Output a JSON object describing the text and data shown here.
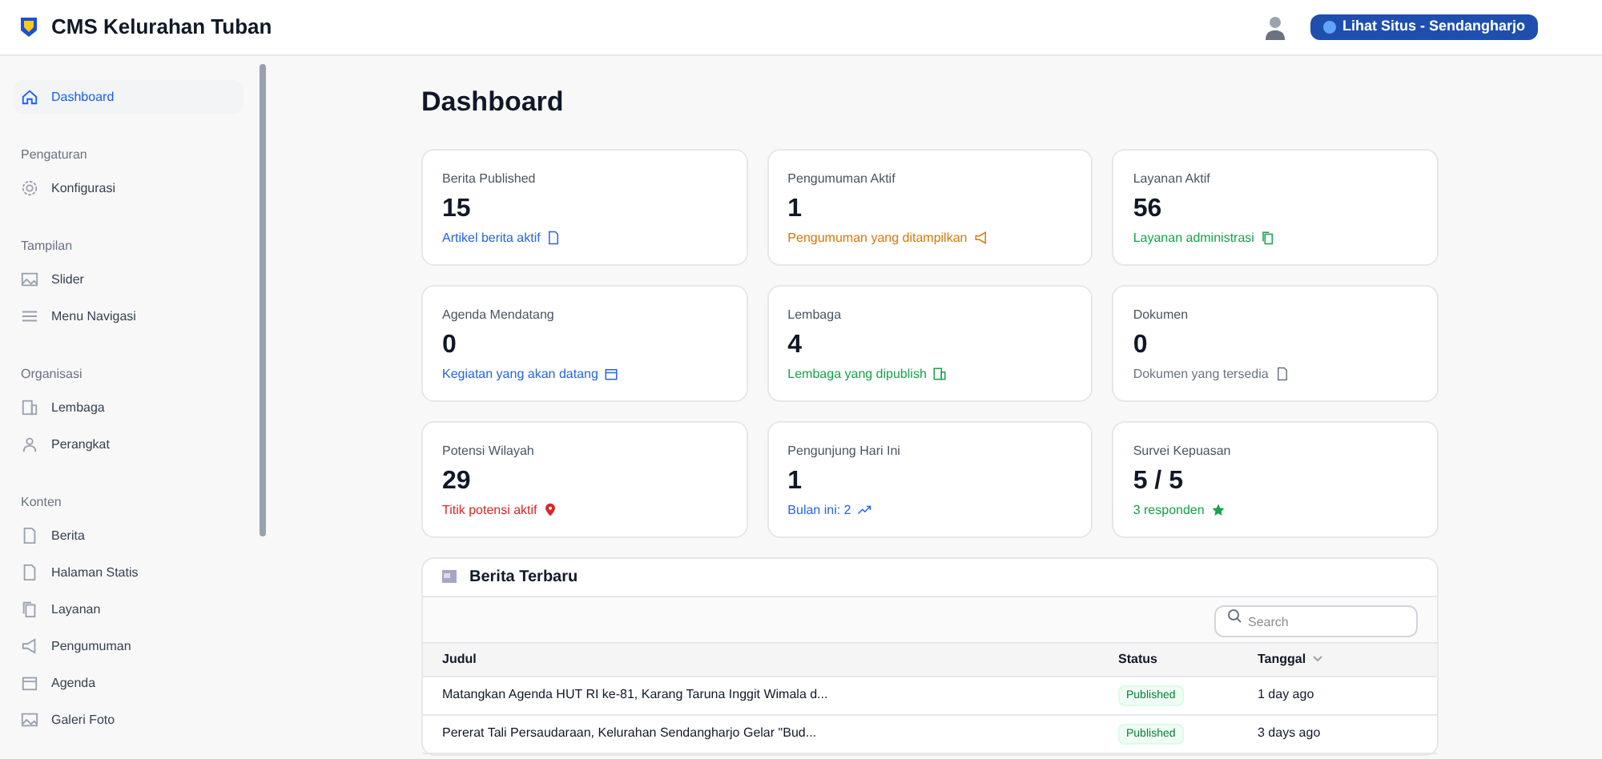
{
  "header": {
    "title": "CMS Kelurahan Tuban",
    "site_button": "Lihat Situs - Sendangharjo"
  },
  "sidebar": {
    "sections": [
      {
        "items": [
          {
            "label": "Dashboard",
            "selected": true
          }
        ]
      },
      {
        "heading": "Pengaturan",
        "items": [
          {
            "label": "Konfigurasi",
            "selected": false
          }
        ]
      },
      {
        "heading": "Tampilan",
        "items": [
          {
            "label": "Slider",
            "selected": false
          },
          {
            "label": "Menu Navigasi",
            "selected": false
          }
        ]
      },
      {
        "heading": "Organisasi",
        "items": [
          {
            "label": "Lembaga",
            "selected": false
          },
          {
            "label": "Perangkat",
            "selected": false
          }
        ]
      },
      {
        "heading": "Konten",
        "items": [
          {
            "label": "Berita",
            "selected": false
          },
          {
            "label": "Halaman Statis",
            "selected": false
          },
          {
            "label": "Layanan",
            "selected": false
          },
          {
            "label": "Pengumuman",
            "selected": false
          },
          {
            "label": "Agenda",
            "selected": false
          },
          {
            "label": "Galeri Foto",
            "selected": false
          }
        ]
      }
    ]
  },
  "page_title": "Dashboard",
  "stats": [
    {
      "label": "Berita Published",
      "value": "15",
      "caption": "Artikel berita aktif",
      "color": "#2563eb"
    },
    {
      "label": "Pengumuman Aktif",
      "value": "1",
      "caption": "Pengumuman yang ditampilkan",
      "color": "#d97706"
    },
    {
      "label": "Layanan Aktif",
      "value": "56",
      "caption": "Layanan administrasi",
      "color": "#16a34a"
    },
    {
      "label": "Agenda Mendatang",
      "value": "0",
      "caption": "Kegiatan yang akan datang",
      "color": "#2563eb"
    },
    {
      "label": "Lembaga",
      "value": "4",
      "caption": "Lembaga yang dipublish",
      "color": "#16a34a"
    },
    {
      "label": "Dokumen",
      "value": "0",
      "caption": "Dokumen yang tersedia",
      "color": "#6b7280"
    },
    {
      "label": "Potensi Wilayah",
      "value": "29",
      "caption": "Titik potensi aktif",
      "color": "#dc2626"
    },
    {
      "label": "Pengunjung Hari Ini",
      "value": "1",
      "caption": "Bulan ini: 2",
      "color": "#2563eb"
    },
    {
      "label": "Survei Kepuasan",
      "value": "5 / 5",
      "caption": "3 responden",
      "color": "#16a34a"
    }
  ],
  "news": {
    "title": "Berita Terbaru",
    "search": {
      "placeholder": "Search"
    },
    "columns": [
      "Judul",
      "Status",
      "Tanggal"
    ],
    "rows": [
      {
        "title": "Matangkan Agenda HUT RI ke-81, Karang Taruna Inggit Wimala d...",
        "status": "Published",
        "date": "1 day ago"
      },
      {
        "title": "Pererat Tali Persaudaraan, Kelurahan Sendangharjo Gelar \"Bud...",
        "status": "Published",
        "date": "3 days ago"
      }
    ]
  }
}
